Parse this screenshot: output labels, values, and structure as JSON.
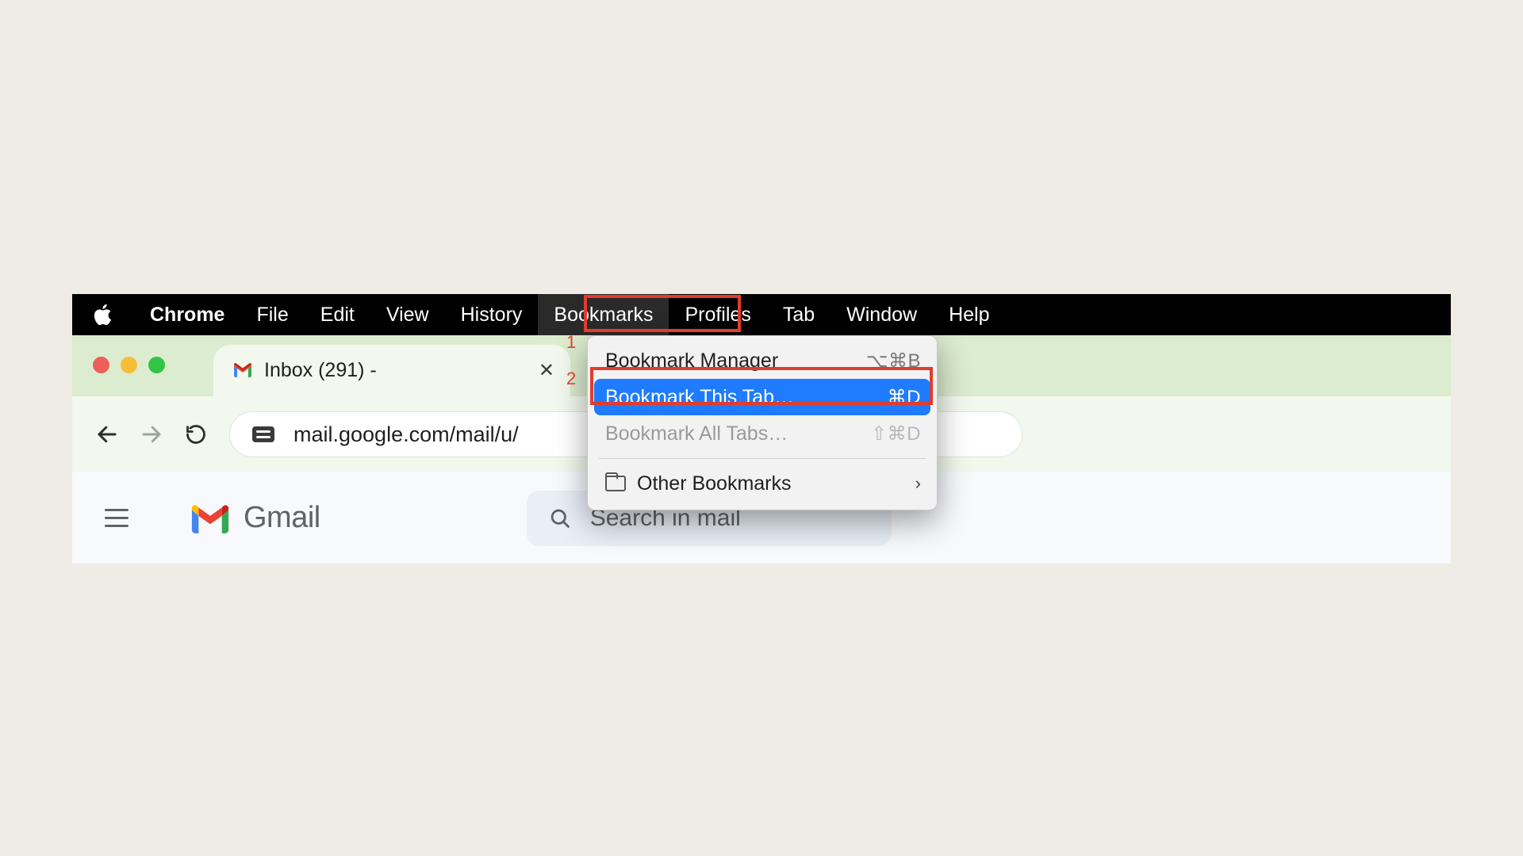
{
  "menubar": {
    "app": "Chrome",
    "items": [
      "File",
      "Edit",
      "View",
      "History",
      "Bookmarks",
      "Profiles",
      "Tab",
      "Window",
      "Help"
    ],
    "open_index": 4
  },
  "annotations": {
    "step1": "1",
    "step2": "2"
  },
  "tab": {
    "title": "Inbox (291) -"
  },
  "address": {
    "url": "mail.google.com/mail/u/"
  },
  "gmail": {
    "brand": "Gmail",
    "search_placeholder": "Search in mail"
  },
  "dropdown": {
    "items": [
      {
        "label": "Bookmark Manager",
        "shortcut": "⌥⌘B",
        "state": "normal"
      },
      {
        "label": "Bookmark This Tab…",
        "shortcut": "⌘D",
        "state": "selected"
      },
      {
        "label": "Bookmark All Tabs…",
        "shortcut": "⇧⌘D",
        "state": "disabled"
      }
    ],
    "other": {
      "label": "Other Bookmarks"
    }
  }
}
